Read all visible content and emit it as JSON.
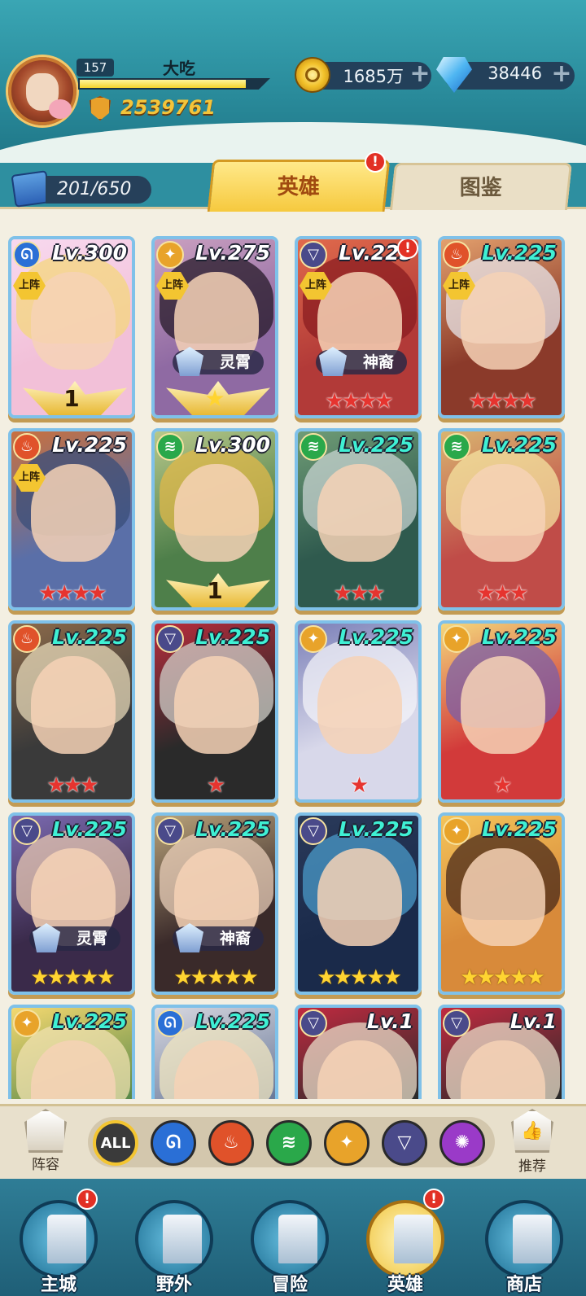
{
  "player": {
    "level": "157",
    "name": "大吃",
    "exp_fraction": 0.88,
    "power": "2539761"
  },
  "currency": {
    "gold": "1685万",
    "gems": "38446",
    "plus": "+"
  },
  "collection": {
    "count": "201/650"
  },
  "tabs": {
    "heroes": "英雄",
    "codex": "图鉴",
    "badge": "!"
  },
  "heroes": [
    {
      "level": "Lv.300",
      "element": "water",
      "deployed": true,
      "stars": "",
      "star_color": "",
      "wing": "1",
      "faction": "",
      "level_color": "white",
      "art": [
        "#f8d9ef",
        "#f2c0d8",
        "#f4d77c"
      ]
    },
    {
      "level": "Lv.275",
      "element": "light",
      "deployed": true,
      "stars": "★",
      "star_color": "gold-wing",
      "wing": "",
      "faction": "灵霄",
      "level_color": "white",
      "art": [
        "#caa0c0",
        "#8f6aa3",
        "#251a28"
      ]
    },
    {
      "level": "Lv.225",
      "element": "dark",
      "deployed": true,
      "stars": "★★★★",
      "star_color": "red",
      "wing": "",
      "faction": "神裔",
      "level_color": "white",
      "badge": "!",
      "art": [
        "#e06a4c",
        "#b23a38",
        "#8a1c20"
      ]
    },
    {
      "level": "Lv.225",
      "element": "fire",
      "deployed": true,
      "stars": "★★★★",
      "star_color": "red",
      "wing": "",
      "faction": "",
      "level_color": "teal",
      "art": [
        "#e3a06d",
        "#8b3a2a",
        "#e8e6ea"
      ]
    },
    {
      "level": "Lv.225",
      "element": "fire",
      "deployed": true,
      "stars": "★★★★",
      "star_color": "red",
      "wing": "",
      "faction": "",
      "level_color": "white",
      "art": [
        "#c9703e",
        "#5a6fa8",
        "#3a4d7a"
      ]
    },
    {
      "level": "Lv.300",
      "element": "wind",
      "deployed": false,
      "stars": "",
      "star_color": "",
      "wing": "1",
      "faction": "",
      "level_color": "white",
      "art": [
        "#b7c88a",
        "#4e7f4a",
        "#e0b84a"
      ]
    },
    {
      "level": "Lv.225",
      "element": "wind",
      "deployed": false,
      "stars": "★★★",
      "star_color": "red",
      "wing": "",
      "faction": "",
      "level_color": "teal",
      "art": [
        "#6f9c76",
        "#2f5a4e",
        "#c7d3d0"
      ]
    },
    {
      "level": "Lv.225",
      "element": "wind",
      "deployed": false,
      "stars": "★★★",
      "star_color": "red",
      "wing": "",
      "faction": "",
      "level_color": "teal",
      "art": [
        "#d9b470",
        "#c04c48",
        "#f4e3a0"
      ]
    },
    {
      "level": "Lv.225",
      "element": "fire",
      "deployed": false,
      "stars": "★★★",
      "star_color": "red",
      "wing": "",
      "faction": "",
      "level_color": "teal",
      "art": [
        "#8c6a4a",
        "#3a3a3a",
        "#e6d8b8"
      ]
    },
    {
      "level": "Lv.225",
      "element": "dark",
      "deployed": false,
      "stars": "★",
      "star_color": "red",
      "wing": "",
      "faction": "",
      "level_color": "teal",
      "art": [
        "#b82c3c",
        "#2a2a2a",
        "#d0cfc8"
      ]
    },
    {
      "level": "Lv.225",
      "element": "light",
      "deployed": false,
      "stars": "★",
      "star_color": "red",
      "wing": "",
      "faction": "",
      "level_color": "teal",
      "art": [
        "#7b80b8",
        "#d8d8ea",
        "#f3f3f8"
      ]
    },
    {
      "level": "Lv.225",
      "element": "light",
      "deployed": false,
      "stars": "★",
      "star_color": "red",
      "wing": "",
      "faction": "",
      "level_color": "teal",
      "art": [
        "#f4d77c",
        "#d23a3a",
        "#7b5fa8"
      ]
    },
    {
      "level": "Lv.225",
      "element": "dark",
      "deployed": false,
      "stars": "★★★★★",
      "star_color": "gold",
      "wing": "",
      "faction": "灵霄",
      "level_color": "teal",
      "art": [
        "#7b6ab0",
        "#3a2a4a",
        "#e6c6b0"
      ]
    },
    {
      "level": "Lv.225",
      "element": "dark",
      "deployed": false,
      "stars": "★★★★★",
      "star_color": "gold",
      "wing": "",
      "faction": "神裔",
      "level_color": "teal",
      "art": [
        "#b8a27a",
        "#3a2a2a",
        "#e8cdb8"
      ]
    },
    {
      "level": "Lv.225",
      "element": "dark",
      "deployed": false,
      "stars": "★★★★★",
      "star_color": "gold",
      "wing": "",
      "faction": "",
      "level_color": "teal",
      "art": [
        "#2a3a5a",
        "#1a2a4a",
        "#4a9ac8"
      ]
    },
    {
      "level": "Lv.225",
      "element": "light",
      "deployed": false,
      "stars": "★★★★★",
      "star_color": "gold",
      "wing": "",
      "faction": "",
      "level_color": "teal",
      "art": [
        "#f4c45a",
        "#d88a3a",
        "#4a2a1a"
      ]
    },
    {
      "level": "Lv.225",
      "element": "light",
      "deployed": false,
      "stars": "",
      "star_color": "",
      "wing": "",
      "faction": "",
      "level_color": "teal",
      "art": [
        "#f4d870",
        "#5a8a4a",
        "#f0e2b0"
      ]
    },
    {
      "level": "Lv.225",
      "element": "water",
      "deployed": false,
      "stars": "",
      "star_color": "",
      "wing": "",
      "faction": "",
      "level_color": "teal",
      "art": [
        "#d8d8e0",
        "#6a7a9a",
        "#f0e6c0"
      ]
    },
    {
      "level": "Lv.1",
      "element": "dark",
      "deployed": false,
      "stars": "",
      "star_color": "",
      "wing": "",
      "faction": "",
      "level_color": "white",
      "art": [
        "#c02a40",
        "#2a2a2a",
        "#e8dcc8"
      ]
    },
    {
      "level": "Lv.1",
      "element": "dark",
      "deployed": false,
      "stars": "",
      "star_color": "",
      "wing": "",
      "faction": "",
      "level_color": "white",
      "art": [
        "#c02a40",
        "#2a2a2a",
        "#e8dcc8"
      ]
    }
  ],
  "deploy_label": "上阵",
  "elements": {
    "water": {
      "color": "#2a6fd6",
      "glyph": "ᘏ"
    },
    "light": {
      "color": "#e8a32a",
      "glyph": "✦"
    },
    "dark": {
      "color": "#4a4a8a",
      "glyph": "▽"
    },
    "fire": {
      "color": "#e0522a",
      "glyph": "♨"
    },
    "wind": {
      "color": "#2aa84a",
      "glyph": "≋"
    }
  },
  "filters": {
    "team_label": "阵容",
    "recommend_label": "推荐",
    "buttons": [
      {
        "label": "ALL",
        "color": "#3a3a3a",
        "ring": "#f3c531"
      },
      {
        "label": "ᘏ",
        "color": "#2a6fd6",
        "ring": "#2a2a2a"
      },
      {
        "label": "♨",
        "color": "#e0522a",
        "ring": "#2a2a2a"
      },
      {
        "label": "≋",
        "color": "#2aa84a",
        "ring": "#2a2a2a"
      },
      {
        "label": "✦",
        "color": "#e8a32a",
        "ring": "#2a2a2a"
      },
      {
        "label": "▽",
        "color": "#4a4a8a",
        "ring": "#2a2a2a"
      },
      {
        "label": "✺",
        "color": "#9a3ac8",
        "ring": "#2a2a2a"
      }
    ]
  },
  "nav": {
    "city": "主城",
    "wild": "野外",
    "adventure": "冒险",
    "hero": "英雄",
    "shop": "商店"
  }
}
